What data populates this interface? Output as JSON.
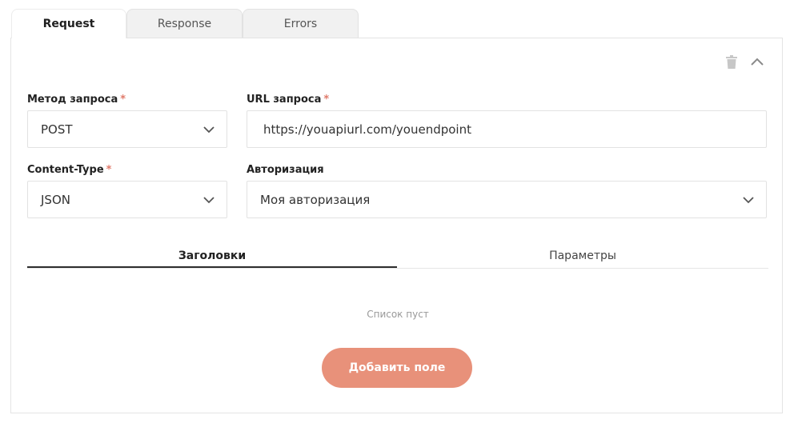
{
  "tabs": [
    {
      "label": "Request",
      "active": true
    },
    {
      "label": "Response",
      "active": false
    },
    {
      "label": "Errors",
      "active": false
    }
  ],
  "toolbar": {
    "delete_icon": "trash-icon",
    "collapse_icon": "chevron-up-icon"
  },
  "form": {
    "method": {
      "label": "Метод запроса",
      "required_mark": "*",
      "value": "POST"
    },
    "url": {
      "label": "URL запроса",
      "required_mark": "*",
      "value": "https://youapiurl.com/youendpoint"
    },
    "content_type": {
      "label": "Content-Type",
      "required_mark": "*",
      "value": "JSON"
    },
    "authorization": {
      "label": "Авторизация",
      "value": "Моя авторизация"
    }
  },
  "subtabs": [
    {
      "label": "Заголовки",
      "active": true
    },
    {
      "label": "Параметры",
      "active": false
    }
  ],
  "empty_text": "Список пуст",
  "add_button_label": "Добавить поле",
  "colors": {
    "accent": "#e8917a",
    "required": "#e07a6a",
    "active_underline": "#2e2e2e"
  }
}
